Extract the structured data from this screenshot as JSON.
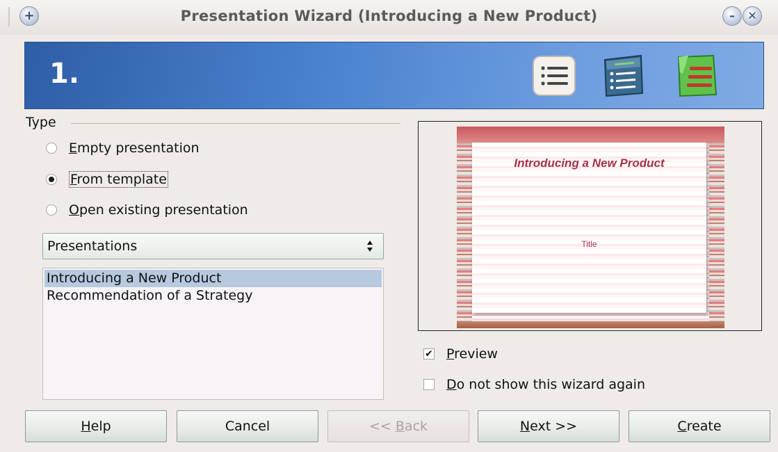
{
  "window": {
    "title": "Presentation Wizard (Introducing a New Product)"
  },
  "banner": {
    "step": "1."
  },
  "type_group": {
    "label": "Type",
    "options": [
      {
        "pre": "",
        "accel": "E",
        "post": "mpty presentation",
        "checked": false
      },
      {
        "pre": "",
        "accel": "F",
        "post": "rom template",
        "checked": true
      },
      {
        "pre": "",
        "accel": "O",
        "post": "pen existing presentation",
        "checked": false
      }
    ]
  },
  "category_select": {
    "selected": "Presentations"
  },
  "template_list": {
    "items": [
      {
        "label": "Introducing a New Product",
        "selected": true
      },
      {
        "label": "Recommendation of a Strategy",
        "selected": false
      }
    ]
  },
  "preview_slide": {
    "title": "Introducing a New Product",
    "subtitle": "Title"
  },
  "options": {
    "preview": {
      "accel": "P",
      "rest": "review",
      "checked": true,
      "mark": "✔"
    },
    "dont_show": {
      "accel": "D",
      "rest": "o not show this wizard again",
      "checked": false
    }
  },
  "buttons": {
    "help": {
      "accel": "H",
      "rest": "elp"
    },
    "cancel": {
      "label": "Cancel"
    },
    "back": {
      "pre": "<< ",
      "accel": "B",
      "rest": "ack"
    },
    "next": {
      "accel": "N",
      "rest": "ext >>"
    },
    "create": {
      "accel": "C",
      "rest": "reate"
    }
  },
  "colors": {
    "banner": "#4a82cf",
    "selection": "#b6c9df",
    "slide_text": "#a62f4a"
  }
}
